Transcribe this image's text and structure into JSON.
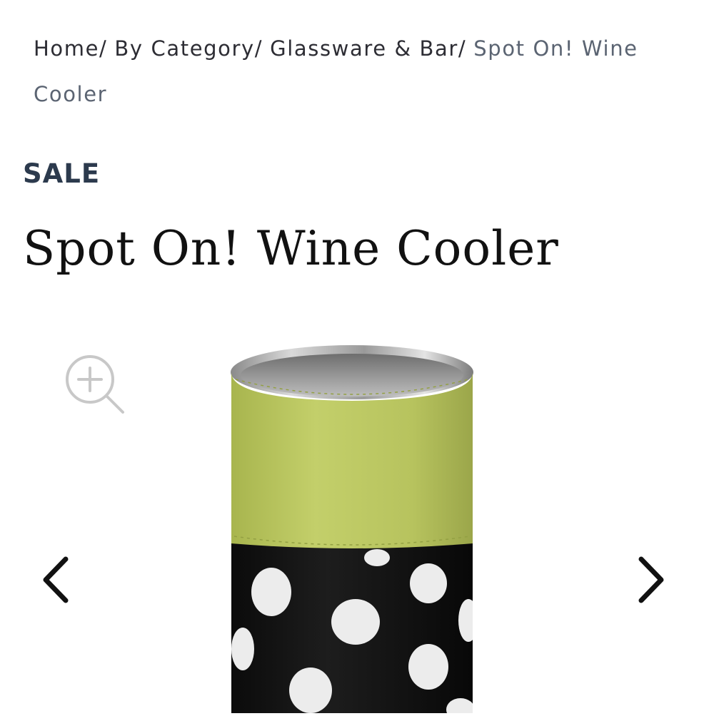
{
  "breadcrumb": {
    "items": [
      {
        "label": "Home"
      },
      {
        "label": "By Category"
      },
      {
        "label": "Glassware & Bar"
      }
    ],
    "separator": "/",
    "current": "Spot On! Wine Cooler"
  },
  "badge": {
    "label": "SALE",
    "color": "#2c3a4d"
  },
  "product": {
    "title": "Spot On! Wine Cooler",
    "image": {
      "subject": "wine cooler with green leather band and black polka-dot hide base"
    }
  },
  "gallery": {
    "zoom_icon": "zoom-in-icon",
    "prev_icon": "chevron-left-icon",
    "next_icon": "chevron-right-icon"
  },
  "colors": {
    "accent_green": "#b9c65e",
    "dark_text": "#2d2d34",
    "muted_text": "#5b6472"
  }
}
